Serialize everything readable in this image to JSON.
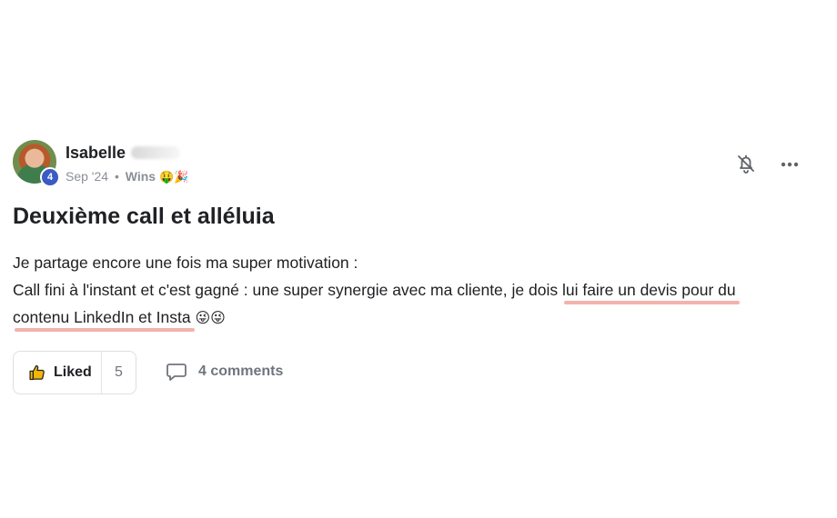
{
  "post": {
    "author": {
      "name": "Isabelle",
      "level": "4"
    },
    "meta": {
      "date": "Sep '24",
      "separator": "•",
      "category": "Wins",
      "category_emoji": "🤑🎉"
    },
    "title": "Deuxième call et alléluia",
    "body": {
      "line1": "Je partage encore une fois ma super motivation :",
      "line2_prefix": "Call fini à l'instant et c'est gagné : une super synergie avec ma cliente, je dois ",
      "line2_highlight": "lui faire un devis pour du",
      "line3_highlight": "contenu LinkedIn et Insta",
      "line3_emoji": "😜😜"
    },
    "actions": {
      "like_label": "Liked",
      "like_count": "5",
      "comments_label": "4 comments"
    },
    "icons": {
      "notification": "bell-off-icon",
      "more": "more-horizontal-icon",
      "like": "thumbs-up-icon",
      "comment": "comment-icon"
    },
    "colors": {
      "badge": "#3a5bc4",
      "highlight": "#f3b2ab",
      "like_thumb": "#f2b705"
    }
  }
}
